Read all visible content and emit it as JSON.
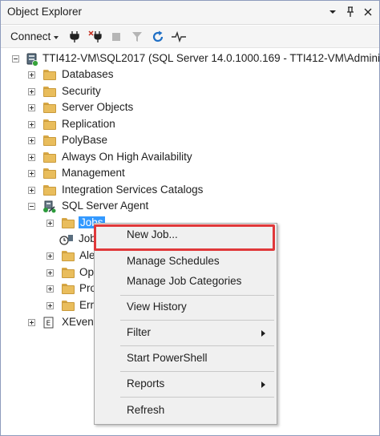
{
  "panel": {
    "title": "Object Explorer",
    "pin_glyph": "▾",
    "autohide_glyph": "ᛣ",
    "close_glyph": "✕"
  },
  "toolbar": {
    "connect_label": "Connect"
  },
  "tree": {
    "server": "TTI412-VM\\SQL2017 (SQL Server 14.0.1000.169 - TTI412-VM\\Adminis",
    "folders": [
      "Databases",
      "Security",
      "Server Objects",
      "Replication",
      "PolyBase",
      "Always On High Availability",
      "Management",
      "Integration Services Catalogs"
    ],
    "agent": "SQL Server Agent",
    "agent_children": [
      "Jobs",
      "Job",
      "Ale",
      "Op",
      "Pro",
      "Err"
    ],
    "xevent": "XEvent"
  },
  "context_menu": {
    "items": [
      {
        "label": "New Job...",
        "submenu": false
      },
      {
        "label": "Manage Schedules",
        "submenu": false
      },
      {
        "label": "Manage Job Categories",
        "submenu": false
      },
      {
        "label": "View History",
        "submenu": false
      },
      {
        "label": "Filter",
        "submenu": true
      },
      {
        "label": "Start PowerShell",
        "submenu": false
      },
      {
        "label": "Reports",
        "submenu": true
      },
      {
        "label": "Refresh",
        "submenu": false
      }
    ],
    "highlight_color": "#e0383a"
  },
  "colors": {
    "selection": "#3399ff",
    "folder": "#e9bd5c"
  }
}
